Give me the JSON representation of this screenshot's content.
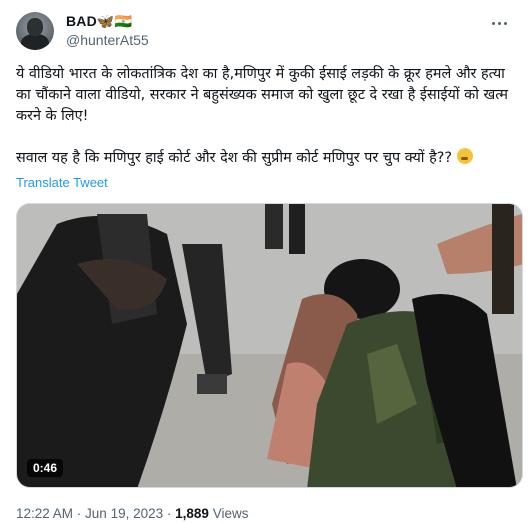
{
  "author": {
    "display_name": "BAD🦋🇮🇳",
    "handle": "@hunterAt55",
    "avatar_icon": "user-avatar"
  },
  "tweet": {
    "paragraph_1": "ये वीडियो भारत के लोकतांत्रिक देश का है,मणिपुर में कुकी ईसाई लड़की के क्रूर हमले और हत्या का चौंकाने वाला वीडियो, सरकार ने बहुसंख्यक समाज को खुला छूट दे रखा है ईसाईयों को खत्म करने के लिए!",
    "paragraph_2": "सवाल यह है कि मणिपुर हाई कोर्ट और देश की सुप्रीम कोर्ट मणिपुर पर चुप क्यों है??",
    "paragraph_2_emoji": "thinking-face",
    "translate_label": "Translate Tweet"
  },
  "media": {
    "duration": "0:46"
  },
  "meta": {
    "time": "12:22 AM",
    "separator": " · ",
    "date": "Jun 19, 2023",
    "separator_2": " · ",
    "views_count": "1,889",
    "views_label": "Views"
  },
  "colors": {
    "link": "#1d9bf0",
    "secondary_text": "#536471"
  }
}
